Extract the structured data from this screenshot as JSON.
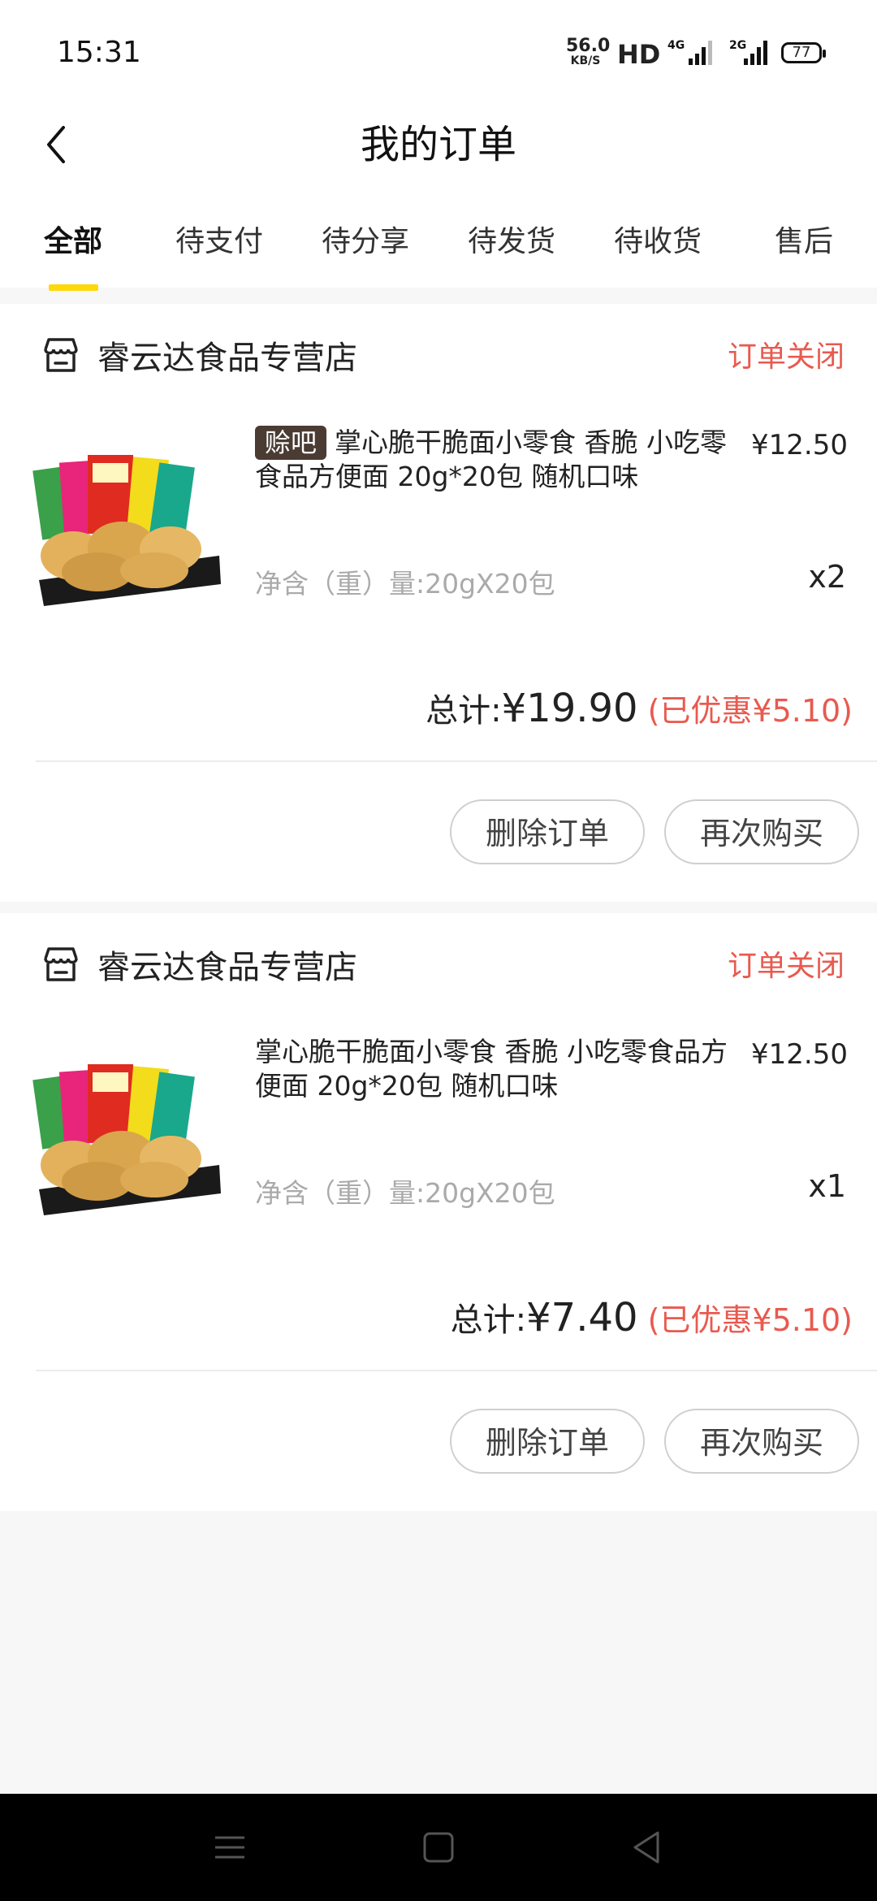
{
  "status_bar": {
    "time": "15:31",
    "net_speed_value": "56.0",
    "net_speed_unit": "KB/S",
    "hd": "HD",
    "sig1": "4G",
    "sig2": "2G",
    "battery": "77"
  },
  "header": {
    "title": "我的订单",
    "back_icon": "chevron-left-icon"
  },
  "tabs": [
    {
      "label": "全部",
      "active": true
    },
    {
      "label": "待支付"
    },
    {
      "label": "待分享"
    },
    {
      "label": "待发货"
    },
    {
      "label": "待收货"
    },
    {
      "label": "售后"
    }
  ],
  "colors": {
    "accent": "#ffd80a",
    "status_red": "#e85a4f",
    "promo_bg": "#4a3b33"
  },
  "orders": [
    {
      "shop_name": "睿云达食品专营店",
      "status": "订单关闭",
      "promo_tag": "赊吧",
      "product_name": "掌心脆干脆面小零食  香脆 小吃零食品方便面  20g*20包 随机口味",
      "price": "¥12.50",
      "spec": "净含（重）量:20gX20包",
      "qty": "x2",
      "total_label": "总计:",
      "total_amount": "¥19.90",
      "discount": "(已优惠¥5.10)",
      "delete_label": "删除订单",
      "rebuy_label": "再次购买"
    },
    {
      "shop_name": "睿云达食品专营店",
      "status": "订单关闭",
      "product_name": "掌心脆干脆面小零食  香脆 小吃零食品方便面  20g*20包 随机口味",
      "price": "¥12.50",
      "spec": "净含（重）量:20gX20包",
      "qty": "x1",
      "total_label": "总计:",
      "total_amount": "¥7.40",
      "discount": "(已优惠¥5.10)",
      "delete_label": "删除订单",
      "rebuy_label": "再次购买"
    }
  ],
  "nav_bar": {
    "menu_icon": "menu-icon",
    "home_icon": "home-square-icon",
    "back_icon": "back-triangle-icon"
  }
}
